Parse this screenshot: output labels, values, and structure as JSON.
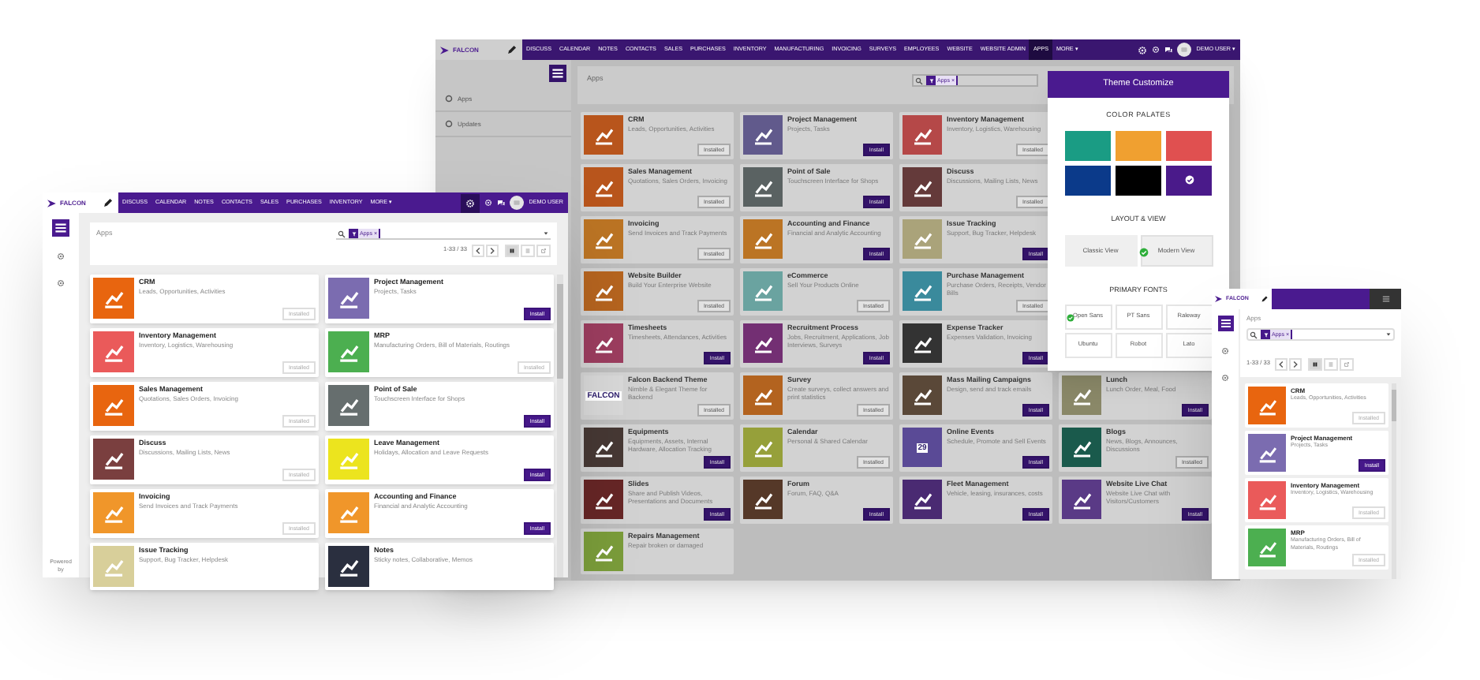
{
  "windows": [
    {
      "kind": "desktop",
      "brand": "FALCON",
      "menu": [
        {
          "label": "DISCUSS",
          "selected": false
        },
        {
          "label": "CALENDAR",
          "selected": false
        },
        {
          "label": "NOTES",
          "selected": false
        },
        {
          "label": "CONTACTS",
          "selected": false
        },
        {
          "label": "SALES",
          "selected": false
        },
        {
          "label": "PURCHASES",
          "selected": false
        },
        {
          "label": "INVENTORY",
          "selected": false
        },
        {
          "label": "MANUFACTURING",
          "selected": false
        },
        {
          "label": "INVOICING",
          "selected": false
        },
        {
          "label": "SURVEYS",
          "selected": false
        },
        {
          "label": "EMPLOYEES",
          "selected": false
        },
        {
          "label": "WEBSITE",
          "selected": false
        },
        {
          "label": "WEBSITE ADMIN",
          "selected": false
        },
        {
          "label": "APPS",
          "selected": true
        },
        {
          "label": "MORE ▾",
          "selected": false
        }
      ],
      "user": "DEMO USER ▾",
      "sidebar": [
        {
          "label": "Apps"
        },
        {
          "label": "Updates"
        }
      ],
      "breadcrumb": "Apps",
      "facet": "Apps ×",
      "apps": [
        {
          "name": "CRM",
          "description": "Leads, Opportunities, Activities",
          "color": "#b8551c",
          "button": "Installed",
          "installed": true
        },
        {
          "name": "Project Management",
          "description": "Projects, Tasks",
          "color": "#615a8c",
          "button": "Install",
          "installed": false
        },
        {
          "name": "Inventory Management",
          "description": "Inventory, Logistics, Warehousing",
          "color": "#b54848",
          "button": "Installed",
          "installed": true
        },
        {
          "name": "Sales Management",
          "description": "Quotations, Sales Orders, Invoicing",
          "color": "#b8551c",
          "button": "Installed",
          "installed": true
        },
        {
          "name": "Point of Sale",
          "description": "Touchscreen Interface for Shops",
          "color": "#5a6262",
          "button": "Install",
          "installed": false
        },
        {
          "name": "Discuss",
          "description": "Discussions, Mailing Lists, News",
          "color": "#643a3a",
          "button": "Installed",
          "installed": true
        },
        {
          "name": "Invoicing",
          "description": "Send Invoices and Track Payments",
          "color": "#bb7424",
          "button": "Installed",
          "installed": true
        },
        {
          "name": "Accounting and Finance",
          "description": "Financial and Analytic Accounting",
          "color": "#bb7424",
          "button": "Install",
          "installed": false
        },
        {
          "name": "Issue Tracking",
          "description": "Support, Bug Tracker, Helpdesk",
          "color": "#aaa37a",
          "button": "Install",
          "installed": false
        },
        {
          "name": "Website Builder",
          "description": "Build Your Enterprise Website",
          "color": "#b5641f",
          "button": "Installed",
          "installed": true
        },
        {
          "name": "eCommerce",
          "description": "Sell Your Products Online",
          "color": "#6aa3a0",
          "button": "Installed",
          "installed": true
        },
        {
          "name": "Purchase Management",
          "description": "Purchase Orders, Receipts, Vendor Bills",
          "color": "#3a8a9c",
          "button": "Installed",
          "installed": true
        },
        {
          "name": "Timesheets",
          "description": "Timesheets, Attendances, Activities",
          "color": "#9c3d5f",
          "button": "Install",
          "installed": false
        },
        {
          "name": "Recruitment Process",
          "description": "Jobs, Recruitment, Applications, Job Interviews, Surveys",
          "color": "#732f73",
          "button": "Install",
          "installed": false
        },
        {
          "name": "Expense Tracker",
          "description": "Expenses Validation, Invoicing",
          "color": "#333333",
          "button": "Install",
          "installed": false
        },
        {
          "name": "Falcon Backend Theme",
          "description": "Nimble & Elegant Theme for Backend",
          "color": "#d8d8d8",
          "icon_text": "FALCON",
          "button": "Installed",
          "installed": true
        },
        {
          "name": "Survey",
          "description": "Create surveys, collect answers and print statistics",
          "color": "#b3631f",
          "button": "Installed",
          "installed": true
        },
        {
          "name": "Mass Mailing Campaigns",
          "description": "Design, send and track emails",
          "color": "#5a4838",
          "button": "Install",
          "installed": false
        },
        {
          "name": "Equipments",
          "description": "Equipments, Assets, Internal Hardware, Allocation Tracking",
          "color": "#463834",
          "button": "Install",
          "installed": false
        },
        {
          "name": "Calendar",
          "description": "Personal & Shared Calendar",
          "color": "#96a03a",
          "button": "Installed",
          "installed": true
        },
        {
          "name": "Online Events",
          "description": "Schedule, Promote and Sell Events",
          "color": "#5a4a96",
          "icon_text": "29",
          "button": "Install",
          "installed": false
        },
        {
          "name": "Slides",
          "description": "Share and Publish Videos, Presentations and Documents",
          "color": "#662626",
          "button": "Install",
          "installed": false
        },
        {
          "name": "Forum",
          "description": "Forum, FAQ, Q&A",
          "color": "#553828",
          "button": "Install",
          "installed": false
        },
        {
          "name": "Fleet Management",
          "description": "Vehicle, leasing, insurances, costs",
          "color": "#4a2a72",
          "button": "Install",
          "installed": false
        },
        {
          "name": "Repairs Management",
          "description": "Repair broken or damaged",
          "color": "#7a9c3a"
        }
      ],
      "side_apps": [
        {
          "name": "Lunch",
          "description": "Lunch Order, Meal, Food",
          "color": "#8a8868",
          "button": "Install",
          "installed": false
        },
        {
          "name": "Blogs",
          "description": "News, Blogs, Announces, Discussions",
          "color": "#1a5a4c",
          "button": "Installed",
          "installed": true
        },
        {
          "name": "Website Live Chat",
          "description": "Website Live Chat with Visitors/Customers",
          "color": "#5a3a86",
          "button": "Install",
          "installed": false
        }
      ],
      "theme_panel": {
        "title": "Theme Customize",
        "palette_heading": "COLOR PALATES",
        "palettes": [
          {
            "color": "#1a9c84",
            "selected": false
          },
          {
            "color": "#f0a030",
            "selected": false
          },
          {
            "color": "#e05050",
            "selected": false
          },
          {
            "color": "#0b3a8a",
            "selected": false
          },
          {
            "color": "#000000",
            "selected": false
          },
          {
            "color": "#4a1a8a",
            "selected": true
          }
        ],
        "layout_heading": "LAYOUT & VIEW",
        "layouts": [
          {
            "label": "Classic View",
            "selected": false
          },
          {
            "label": "Modern View",
            "selected": true
          }
        ],
        "fonts_heading": "PRIMARY FONTS",
        "fonts": [
          {
            "label": "Open Sans",
            "selected": true
          },
          {
            "label": "PT Sans",
            "selected": false
          },
          {
            "label": "Raleway",
            "selected": false
          },
          {
            "label": "Ubuntu",
            "selected": false
          },
          {
            "label": "Robot",
            "selected": false
          },
          {
            "label": "Lato",
            "selected": false
          }
        ]
      }
    },
    {
      "kind": "laptop",
      "brand": "FALCON",
      "menu": [
        {
          "label": "DISCUSS",
          "selected": false
        },
        {
          "label": "CALENDAR",
          "selected": false
        },
        {
          "label": "NOTES",
          "selected": false
        },
        {
          "label": "CONTACTS",
          "selected": false
        },
        {
          "label": "SALES",
          "selected": false
        },
        {
          "label": "PURCHASES",
          "selected": false
        },
        {
          "label": "INVENTORY",
          "selected": false
        },
        {
          "label": "MORE ▾",
          "selected": false
        }
      ],
      "user": "DEMO USER",
      "breadcrumb": "Apps",
      "facet": "Apps ×",
      "pager": "1-33 / 33",
      "views": [
        {
          "selected": true
        },
        {
          "selected": false
        },
        {
          "selected": false
        }
      ],
      "powered": "Powered by",
      "apps": [
        {
          "name": "CRM",
          "description": "Leads, Opportunities, Activities",
          "color": "#e8650f",
          "button": "Installed",
          "installed": true
        },
        {
          "name": "Project Management",
          "description": "Projects, Tasks",
          "color": "#7b6cb0",
          "button": "Install",
          "installed": false
        },
        {
          "name": "Inventory Management",
          "description": "Inventory, Logistics, Warehousing",
          "color": "#ea5a5a",
          "button": "Installed",
          "installed": true
        },
        {
          "name": "MRP",
          "description": "Manufacturing Orders, Bill of Materials, Routings",
          "color": "#4caf50",
          "button": "Installed",
          "installed": true
        },
        {
          "name": "Sales Management",
          "description": "Quotations, Sales Orders, Invoicing",
          "color": "#e8650f",
          "button": "Installed",
          "installed": true
        },
        {
          "name": "Point of Sale",
          "description": "Touchscreen Interface for Shops",
          "color": "#666e6e",
          "button": "Install",
          "installed": false
        },
        {
          "name": "Discuss",
          "description": "Discussions, Mailing Lists, News",
          "color": "#7a3f3f",
          "button": "Installed",
          "installed": true
        },
        {
          "name": "Leave Management",
          "description": "Holidays, Allocation and Leave Requests",
          "color": "#ece41e",
          "button": "Install",
          "installed": false
        },
        {
          "name": "Invoicing",
          "description": "Send Invoices and Track Payments",
          "color": "#f0962a",
          "button": "Installed",
          "installed": true
        },
        {
          "name": "Accounting and Finance",
          "description": "Financial and Analytic Accounting",
          "color": "#f0962a",
          "button": "Install",
          "installed": false
        },
        {
          "name": "Issue Tracking",
          "description": "Support, Bug Tracker, Helpdesk",
          "color": "#d8cf9a"
        },
        {
          "name": "Notes",
          "description": "Sticky notes, Collaborative, Memos",
          "color": "#2a2f3f"
        }
      ]
    },
    {
      "kind": "mobile",
      "brand": "FALCON",
      "breadcrumb": "Apps",
      "facet": "Apps ×",
      "pager": "1-33 / 33",
      "views": [
        {
          "selected": true
        },
        {
          "selected": false
        },
        {
          "selected": false
        }
      ],
      "apps": [
        {
          "name": "CRM",
          "description": "Leads, Opportunities, Activities",
          "color": "#e8650f",
          "button": "Installed",
          "installed": true
        },
        {
          "name": "Project Management",
          "description": "Projects, Tasks",
          "color": "#7b6cb0",
          "button": "Install",
          "installed": false
        },
        {
          "name": "Inventory Management",
          "description": "Inventory, Logistics, Warehousing",
          "color": "#ea5a5a",
          "button": "Installed",
          "installed": true
        },
        {
          "name": "MRP",
          "description": "Manufacturing Orders, Bill of Materials, Routings",
          "color": "#4caf50",
          "button": "Installed",
          "installed": true
        }
      ]
    }
  ]
}
